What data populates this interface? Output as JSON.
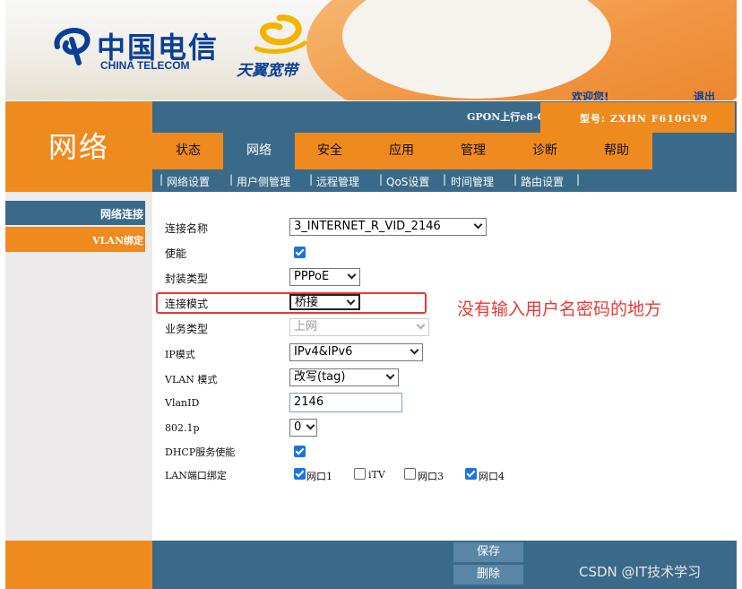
{
  "header": {
    "brand_cn": "中国电信",
    "brand_en": "CHINA TELECOM",
    "sub_brand": "天翼宽带",
    "welcome": "欢迎您!",
    "logout": "退出"
  },
  "section_title": "网络",
  "device": {
    "gpon": "GPON上行e8-C",
    "model": "型号: ZXHN F610GV9"
  },
  "tabs": [
    {
      "label": "状态"
    },
    {
      "label": "网络"
    },
    {
      "label": "安全"
    },
    {
      "label": "应用"
    },
    {
      "label": "管理"
    },
    {
      "label": "诊断"
    },
    {
      "label": "帮助"
    }
  ],
  "active_tab": "网络",
  "subnav": [
    {
      "label": "网络设置"
    },
    {
      "label": "用户侧管理"
    },
    {
      "label": "远程管理"
    },
    {
      "label": "QoS设置"
    },
    {
      "label": "时间管理"
    },
    {
      "label": "路由设置"
    }
  ],
  "sidebar": {
    "items": [
      {
        "label": "网络连接"
      },
      {
        "label": "VLAN绑定"
      }
    ]
  },
  "form": {
    "connection_name": {
      "label": "连接名称",
      "value": "3_INTERNET_R_VID_2146"
    },
    "enable": {
      "label": "使能",
      "checked": true
    },
    "encap_type": {
      "label": "封装类型",
      "value": "PPPoE"
    },
    "conn_mode": {
      "label": "连接模式",
      "value": "桥接"
    },
    "service_type": {
      "label": "业务类型",
      "value": "上网"
    },
    "ip_mode": {
      "label": "IP模式",
      "value": "IPv4&IPv6"
    },
    "vlan_mode": {
      "label": "VLAN 模式",
      "value": "改写(tag)"
    },
    "vlan_id": {
      "label": "VlanID",
      "value": "2146"
    },
    "p8021": {
      "label": "802.1p",
      "value": "0"
    },
    "dhcp": {
      "label": "DHCP服务使能",
      "checked": true
    },
    "lan_bind": {
      "label": "LAN端口绑定",
      "ports": [
        {
          "label": "网口1",
          "checked": true
        },
        {
          "label": "iTV",
          "checked": false
        },
        {
          "label": "网口3",
          "checked": false
        },
        {
          "label": "网口4",
          "checked": true
        }
      ]
    }
  },
  "annotation": "没有输入用户名密码的地方",
  "buttons": {
    "save": "保存",
    "delete": "删除"
  },
  "watermark": "CSDN @IT技术学习",
  "colors": {
    "orange": "#ef8a1e",
    "blue": "#3a6a8a",
    "annotation_red": "#e53935",
    "brand_blue": "#0a3f96"
  }
}
